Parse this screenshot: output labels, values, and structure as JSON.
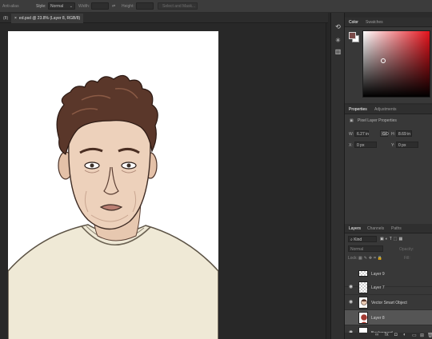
{
  "options_bar": {
    "anti_alias": "Anti-alias",
    "style_label": "Style:",
    "style_value": "Normal",
    "width_label": "Width:",
    "height_label": "Height:",
    "select_mask": "Select and Mask..."
  },
  "tabs": [
    {
      "label": "(8)"
    },
    {
      "label": "ed.psd @ 23.8% (Layer 8, RGB/8)",
      "close": "×"
    }
  ],
  "color_panel": {
    "tabs": [
      "Color",
      "Swatches"
    ],
    "foreground": "#7a4a48",
    "background": "#ffffff",
    "hue": "#e5121b"
  },
  "properties": {
    "tabs": [
      "Properties",
      "Adjustments"
    ],
    "title": "Pixel Layer Properties",
    "w_label": "W:",
    "w_value": "6.27 in",
    "link": "GO",
    "h_label": "H:",
    "h_value": "8.69 in",
    "x_label": "X:",
    "x_value": "0 px",
    "y_label": "Y:",
    "y_value": "0 px"
  },
  "layers_panel": {
    "tabs": [
      "Layers",
      "Channels",
      "Paths"
    ],
    "filter": "Kind",
    "blend_mode": "Normal",
    "opacity_label": "Opacity:",
    "lock_label": "Lock:",
    "fill_label": "Fill:",
    "layers": [
      {
        "name": "Layer 9",
        "visible": false
      },
      {
        "name": "Layer 7",
        "visible": true
      },
      {
        "name": "Vector Smart Object",
        "visible": true
      },
      {
        "name": "Layer 8",
        "visible": false,
        "selected": true
      },
      {
        "name": "Background",
        "visible": true
      }
    ]
  },
  "icons": {
    "tool_1": "history-icon",
    "tool_2": "asterisk-brush-icon",
    "tool_3": "histogram-icon",
    "eye": "eye-icon"
  }
}
